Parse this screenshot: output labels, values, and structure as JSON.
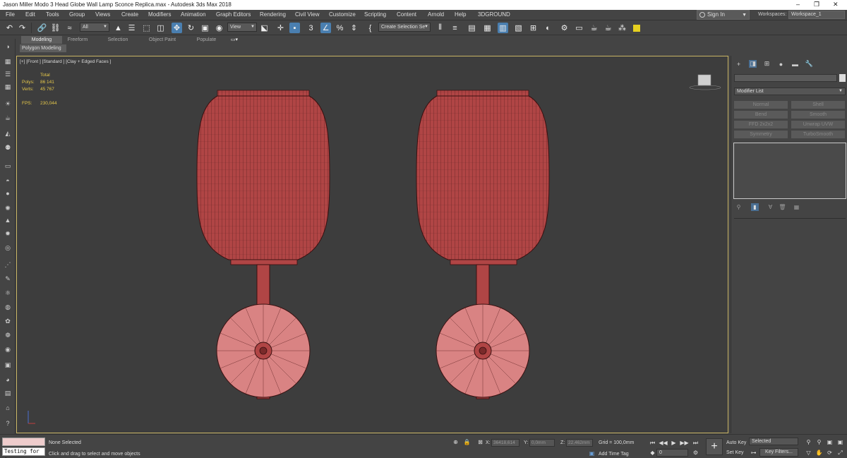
{
  "window": {
    "title": "Jason Miller Modo 3 Head Globe Wall Lamp Sconce Replica.max - Autodesk 3ds Max 2018",
    "controls": [
      "–",
      "❐",
      "✕"
    ]
  },
  "menu": {
    "items": [
      "File",
      "Edit",
      "Tools",
      "Group",
      "Views",
      "Create",
      "Modifiers",
      "Animation",
      "Graph Editors",
      "Rendering",
      "Civil View",
      "Customize",
      "Scripting",
      "Content",
      "Arnold",
      "Help",
      "3DGROUND"
    ],
    "sign_in": "Sign In",
    "workspaces_label": "Workspaces:",
    "workspace_value": "Workspace_1"
  },
  "toolbar": {
    "filter_value": "All",
    "refcoord_value": "View",
    "selection_set_placeholder": "Create Selection Se"
  },
  "ribbon": {
    "tabs": [
      "Modeling",
      "Freeform",
      "Selection",
      "Object Paint",
      "Populate"
    ],
    "subtab": "Polygon Modeling"
  },
  "viewport": {
    "label": "[+] [Front ] [Standard ] [Clay + Edged Faces ]",
    "stats": {
      "total_label": "Total",
      "polys_label": "Polys:",
      "polys_value": "86 141",
      "verts_label": "Verts:",
      "verts_value": "45 767",
      "fps_label": "FPS:",
      "fps_value": "230,044"
    },
    "model_color": "#b04545"
  },
  "command_panel": {
    "modifier_list": "Modifier List",
    "modifier_buttons": [
      "Normal",
      "Shell",
      "Bend",
      "Smooth",
      "FFD 2x2x2",
      "Unwrap UVW",
      "Symmetry",
      "TurboSmooth"
    ]
  },
  "status": {
    "selection": "None Selected",
    "prompt": "Click and drag to select and move objects",
    "listener_text": "Testing for :",
    "x_label": "X:",
    "x_value": "36418,614",
    "y_label": "Y:",
    "y_value": "0,0mm",
    "z_label": "Z:",
    "z_value": "22,462mm",
    "grid": "Grid = 100,0mm",
    "add_time_tag": "Add Time Tag",
    "frame_value": "0",
    "auto_key": "Auto Key",
    "set_key": "Set Key",
    "key_mode": "Selected",
    "key_filters": "Key Filters..."
  }
}
